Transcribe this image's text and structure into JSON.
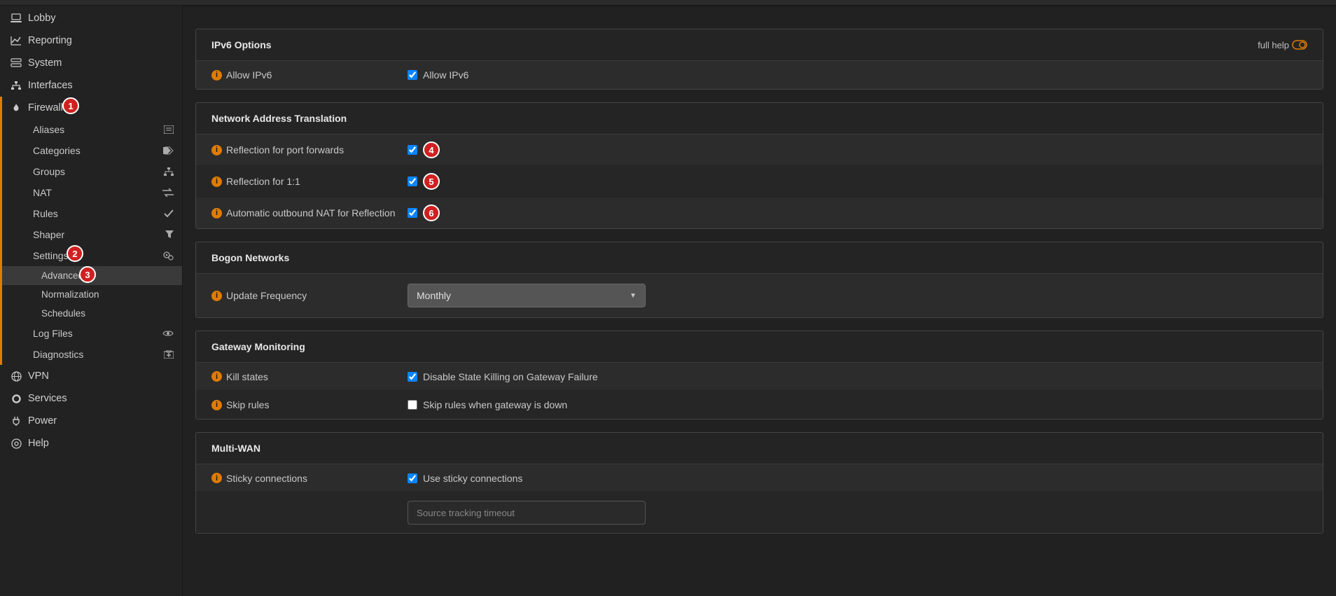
{
  "sidebar": {
    "lobby": "Lobby",
    "reporting": "Reporting",
    "system": "System",
    "interfaces": "Interfaces",
    "firewall": "Firewall",
    "fw_sub": {
      "aliases": "Aliases",
      "categories": "Categories",
      "groups": "Groups",
      "nat": "NAT",
      "rules": "Rules",
      "shaper": "Shaper",
      "settings": "Settings",
      "settings_sub": {
        "advanced": "Advanced",
        "normalization": "Normalization",
        "schedules": "Schedules"
      },
      "logfiles": "Log Files",
      "diagnostics": "Diagnostics"
    },
    "vpn": "VPN",
    "services": "Services",
    "power": "Power",
    "help": "Help"
  },
  "sections": {
    "ipv6": {
      "title": "IPv6 Options",
      "full_help": "full help",
      "allow_label": "Allow IPv6",
      "allow_cb_label": "Allow IPv6"
    },
    "nat": {
      "title": "Network Address Translation",
      "r1": "Reflection for port forwards",
      "r2": "Reflection for 1:1",
      "r3": "Automatic outbound NAT for Reflection"
    },
    "bogon": {
      "title": "Bogon Networks",
      "label": "Update Frequency",
      "value": "Monthly"
    },
    "gateway": {
      "title": "Gateway Monitoring",
      "kill_label": "Kill states",
      "kill_cb": "Disable State Killing on Gateway Failure",
      "skip_label": "Skip rules",
      "skip_cb": "Skip rules when gateway is down"
    },
    "multiwan": {
      "title": "Multi-WAN",
      "sticky_label": "Sticky connections",
      "sticky_cb": "Use sticky connections",
      "timeout_ph": "Source tracking timeout"
    }
  },
  "badges": {
    "1": "1",
    "2": "2",
    "3": "3",
    "4": "4",
    "5": "5",
    "6": "6"
  }
}
